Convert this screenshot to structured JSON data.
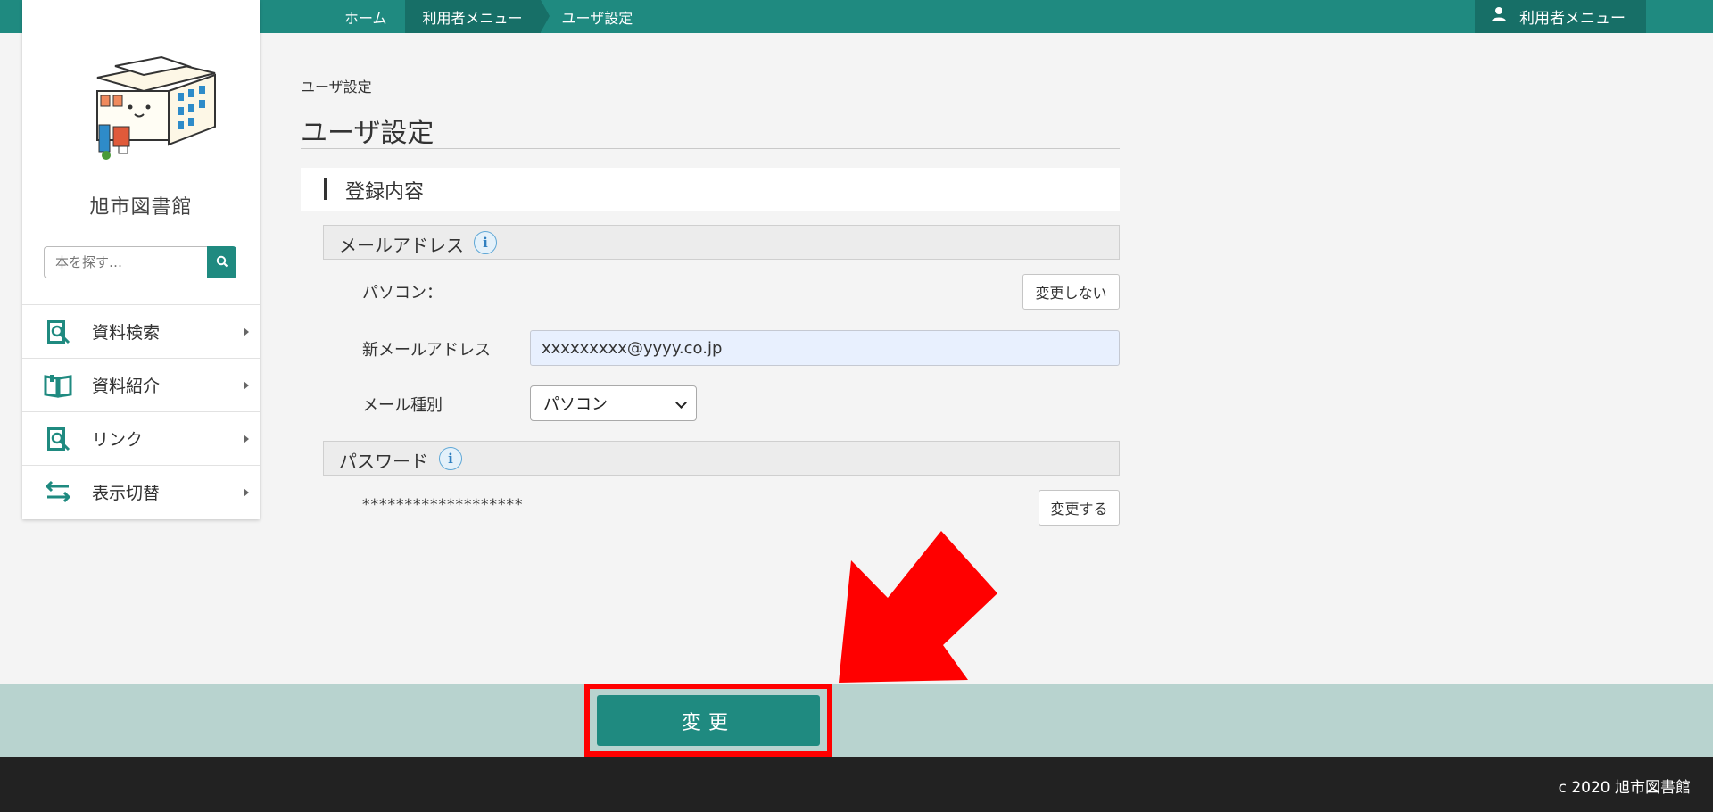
{
  "breadcrumb": {
    "home": "ホーム",
    "user_menu": "利用者メニュー",
    "current": "ユーザ設定"
  },
  "header": {
    "user_menu_label": "利用者メニュー",
    "user_icon": "user-icon"
  },
  "sidebar": {
    "library_name": "旭市図書館",
    "search_placeholder": "本を探す…",
    "search_icon": "search-icon",
    "items": [
      {
        "label": "資料検索",
        "icon": "book-search-icon"
      },
      {
        "label": "資料紹介",
        "icon": "open-book-icon"
      },
      {
        "label": "リンク",
        "icon": "link-search-icon"
      },
      {
        "label": "表示切替",
        "icon": "swap-arrows-icon"
      }
    ]
  },
  "main": {
    "small_title": "ユーザ設定",
    "page_title": "ユーザ設定",
    "section_title": "登録内容",
    "email_section": {
      "title": "メールアドレス",
      "pc_label": "パソコン：",
      "no_change_button": "変更しない",
      "new_email_label": "新メールアドレス",
      "new_email_value": "xxxxxxxxx@yyyy.co.jp",
      "mail_type_label": "メール種別",
      "mail_type_selected": "パソコン"
    },
    "password_section": {
      "title": "パスワード",
      "masked_value": "*******************",
      "change_button": "変更する"
    },
    "info_icon_glyph": "i"
  },
  "action": {
    "submit_label": "変更"
  },
  "footer": {
    "copyright": "c 2020 旭市図書館"
  },
  "colors": {
    "brand": "#1f8a80",
    "brand_dark": "#176f67",
    "action_band": "#b8d3cf",
    "highlight": "#ff0000",
    "footer": "#222222"
  }
}
